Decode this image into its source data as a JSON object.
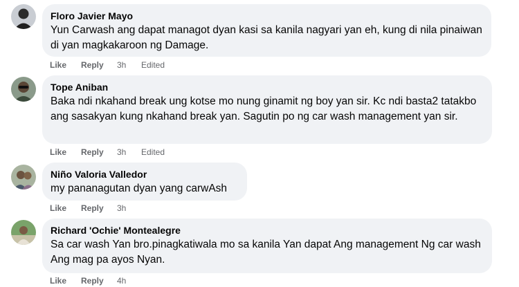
{
  "comments": [
    {
      "author": "Floro Javier Mayo",
      "text": "Yun Carwash ang dapat managot dyan kasi sa kanila nagyari yan eh, kung di nila pinaiwan di yan magkakaroon ng Damage.",
      "like": "Like",
      "reply": "Reply",
      "time": "3h",
      "edited": "Edited"
    },
    {
      "author": "Tope Aniban",
      "text": "Baka ndi nkahand break ung kotse mo nung ginamit ng boy yan sir. Kc ndi basta2 tatakbo ang sasakyan kung nkahand break yan. Sagutin po ng car wash management yan sir.",
      "like": "Like",
      "reply": "Reply",
      "time": "3h",
      "edited": "Edited"
    },
    {
      "author": "Niño Valoria Valledor",
      "text": "my pananagutan dyan yang carwAsh",
      "like": "Like",
      "reply": "Reply",
      "time": "3h"
    },
    {
      "author": "Richard 'Ochie' Montealegre",
      "text": "Sa car wash Yan bro.pinagkatiwala mo sa kanila Yan dapat Ang management Ng car wash Ang mag pa ayos Nyan.",
      "like": "Like",
      "reply": "Reply",
      "time": "4h"
    }
  ]
}
